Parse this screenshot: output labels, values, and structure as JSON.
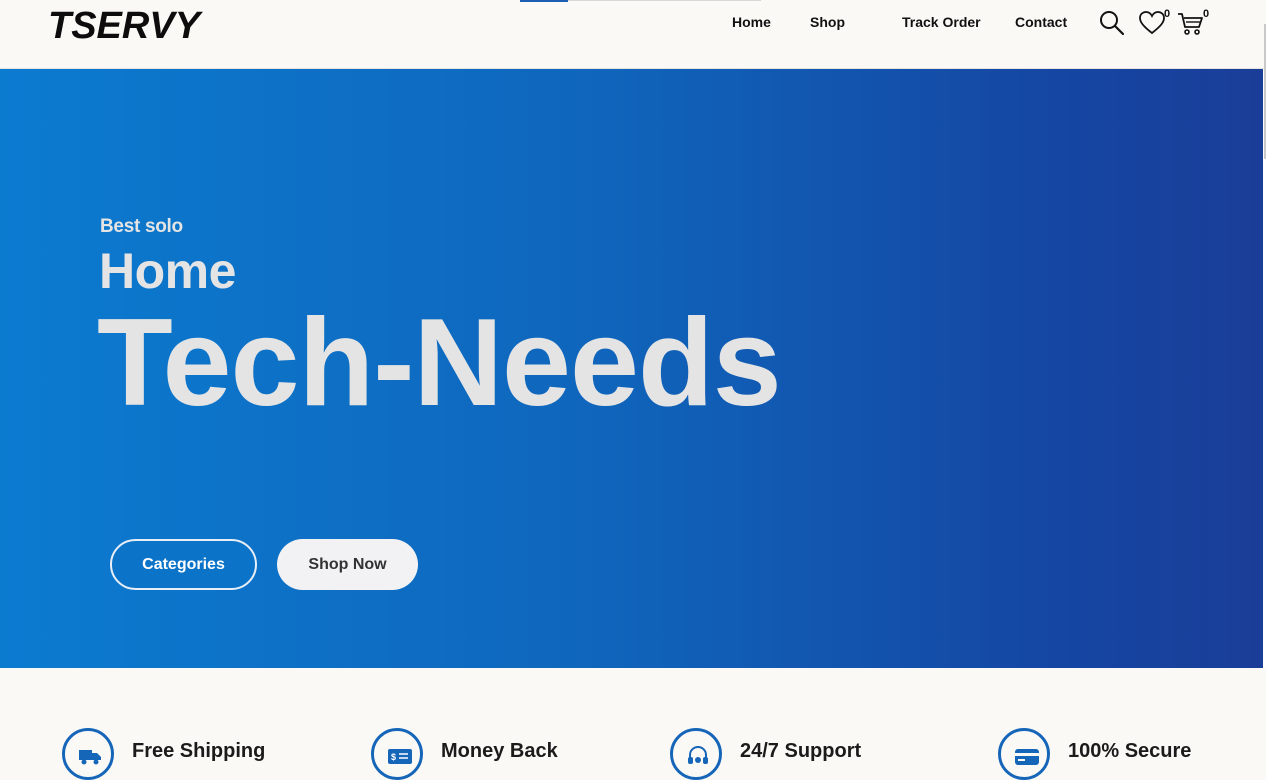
{
  "brand": {
    "logo_text": "TSERVY"
  },
  "nav": {
    "items": [
      {
        "label": "Home"
      },
      {
        "label": "Shop"
      },
      {
        "label": "Track Order"
      },
      {
        "label": "Contact"
      }
    ],
    "wishlist_count": "0",
    "cart_count": "0"
  },
  "hero": {
    "kicker": "Best solo",
    "title_line1": "Home",
    "title_line2": "Tech-Needs",
    "buttons": {
      "categories": "Categories",
      "shop_now": "Shop Now"
    }
  },
  "features": [
    {
      "title": "Free Shipping",
      "icon": "truck-icon"
    },
    {
      "title": "Money Back",
      "icon": "money-icon"
    },
    {
      "title": "24/7 Support",
      "icon": "headset-icon"
    },
    {
      "title": "100% Secure",
      "icon": "credit-card-icon"
    }
  ],
  "colors": {
    "accent": "#1565b8",
    "hero_start": "#0b7bd0",
    "hero_end": "#1a3e98"
  }
}
